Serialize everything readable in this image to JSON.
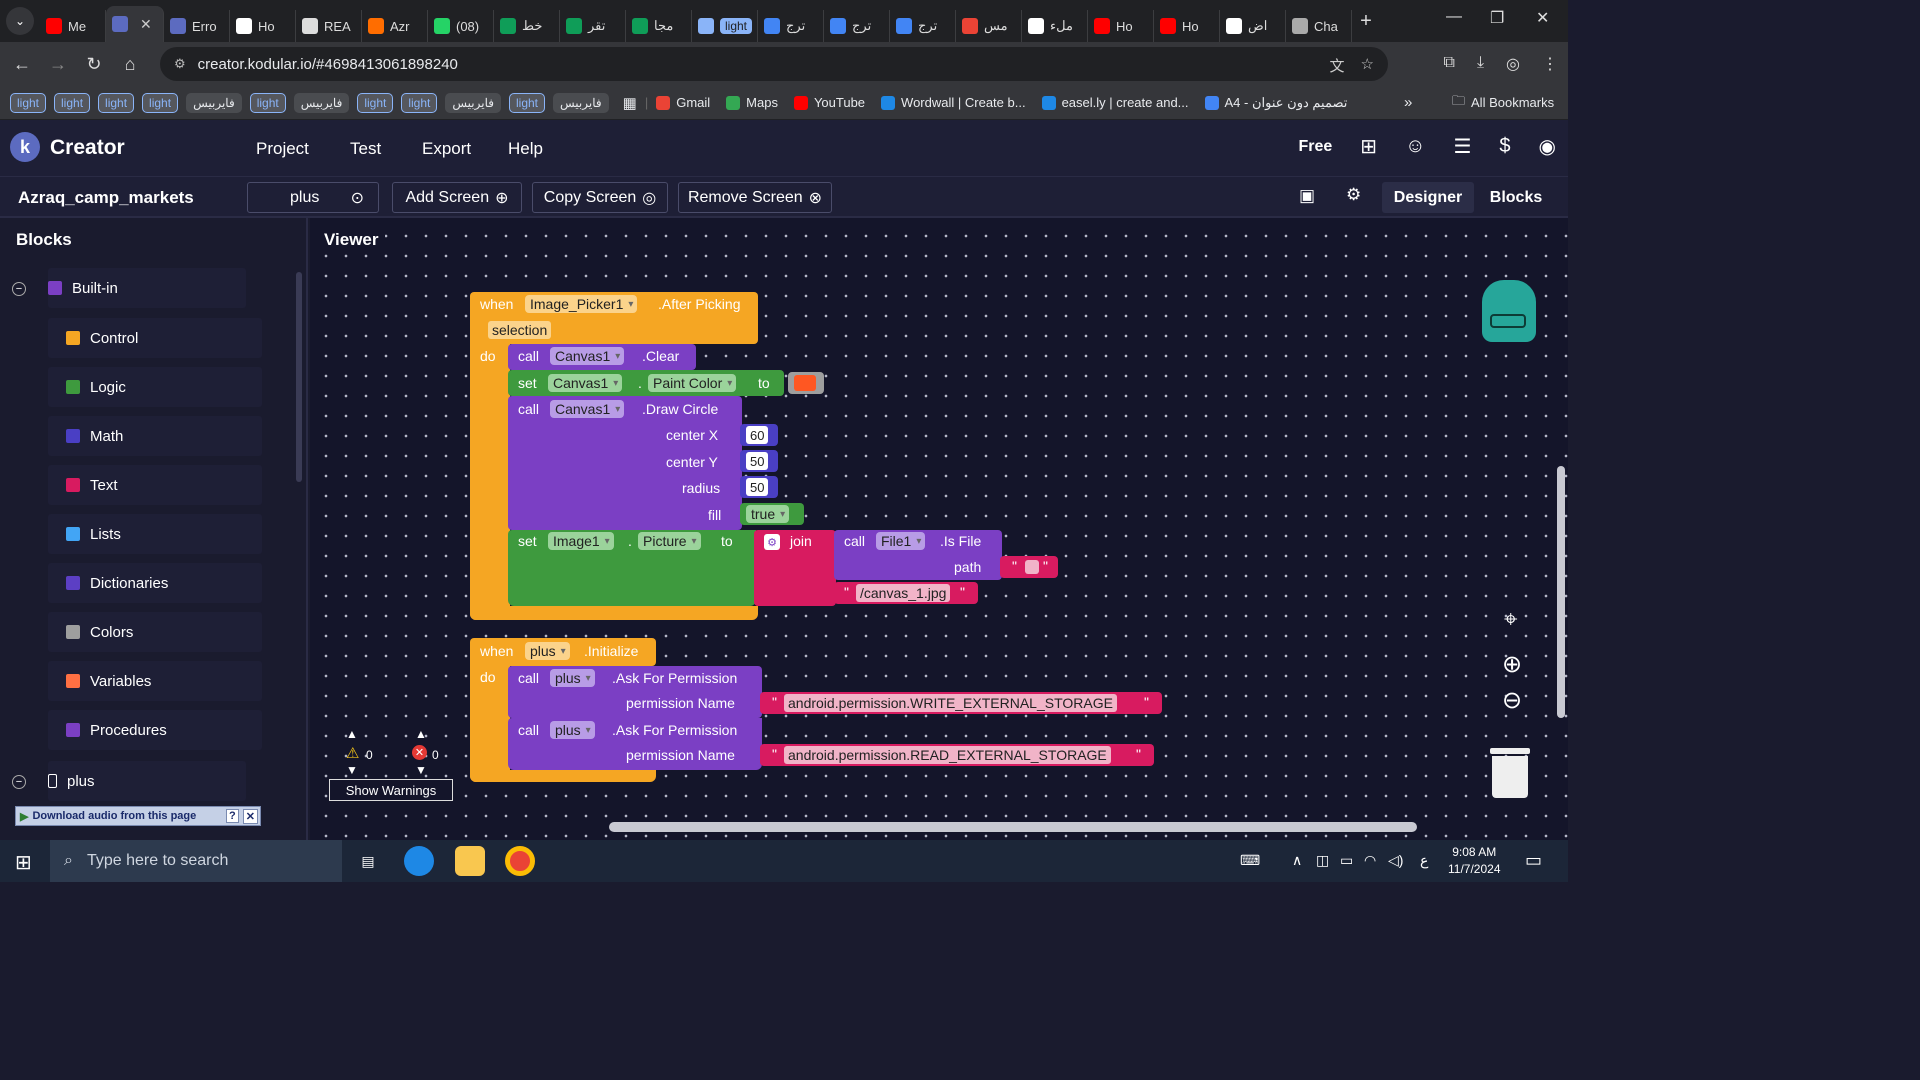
{
  "browser": {
    "tabs": [
      {
        "title": "Me",
        "color": "#ff0000"
      },
      {
        "title": "",
        "color": "#5c6bc0",
        "active": true
      },
      {
        "title": "Erro",
        "color": "#5c6bc0"
      },
      {
        "title": "Ho",
        "color": "#ffffff"
      },
      {
        "title": "REA",
        "color": "#dddddd"
      },
      {
        "title": "Azr",
        "color": "#ff6d00"
      },
      {
        "title": "(08)",
        "color": "#25d366"
      },
      {
        "title": "خط",
        "color": "#0f9d58"
      },
      {
        "title": "تقر",
        "color": "#0f9d58"
      },
      {
        "title": "مجا",
        "color": "#0f9d58"
      },
      {
        "title": "light",
        "color": "#8ab4f8",
        "chip": true
      },
      {
        "title": "ترج",
        "color": "#4285f4"
      },
      {
        "title": "ترج",
        "color": "#4285f4"
      },
      {
        "title": "ترج",
        "color": "#4285f4"
      },
      {
        "title": "مس",
        "color": "#ea4335"
      },
      {
        "title": "ملء",
        "color": "#ffffff"
      },
      {
        "title": "Ho",
        "color": "#ff0000"
      },
      {
        "title": "Ho",
        "color": "#ff0000"
      },
      {
        "title": "اض",
        "color": "#ffffff"
      },
      {
        "title": "Cha",
        "color": "#aaaaaa"
      }
    ],
    "url": "creator.kodular.io/#4698413061898240",
    "bookmark_chips": [
      "light",
      "light",
      "light",
      "light",
      "فايربيس",
      "light",
      "فايربيس",
      "light",
      "light",
      "فايربيس",
      "light",
      "فايربيس"
    ],
    "bookmarks": [
      {
        "label": "Gmail",
        "color": "#ea4335"
      },
      {
        "label": "Maps",
        "color": "#34a853"
      },
      {
        "label": "YouTube",
        "color": "#ff0000"
      },
      {
        "label": "Wordwall | Create b...",
        "color": "#1e88e5"
      },
      {
        "label": "easel.ly | create and...",
        "color": "#1e88e5"
      },
      {
        "label": "A4 - تصميم دون عنوان",
        "color": "#4285f4"
      }
    ],
    "all_bookmarks": "All Bookmarks"
  },
  "app": {
    "brand": "Creator",
    "logo_letter": "k",
    "menu": [
      "Project",
      "Test",
      "Export",
      "Help"
    ],
    "plan": "Free",
    "project_name": "Azraq_camp_markets",
    "screen_select": "plus",
    "add_screen": "Add Screen",
    "copy_screen": "Copy Screen",
    "remove_screen": "Remove Screen",
    "designer": "Designer",
    "blocks": "Blocks"
  },
  "sidebar": {
    "title": "Blocks",
    "builtin": "Built-in",
    "categories": [
      {
        "label": "Control",
        "color": "#f5a623"
      },
      {
        "label": "Logic",
        "color": "#3e9a3e"
      },
      {
        "label": "Math",
        "color": "#4a3fc4"
      },
      {
        "label": "Text",
        "color": "#d81b60"
      },
      {
        "label": "Lists",
        "color": "#42a5f5"
      },
      {
        "label": "Dictionaries",
        "color": "#5c3fc4"
      },
      {
        "label": "Colors",
        "color": "#9e9e9e"
      },
      {
        "label": "Variables",
        "color": "#ff7043"
      },
      {
        "label": "Procedures",
        "color": "#7b3fc4"
      }
    ],
    "screen_node": "plus",
    "download_audio": "Download audio from this page"
  },
  "viewer": {
    "title": "Viewer",
    "event1": {
      "when": "when",
      "component": "Image_Picker1",
      "event": ".After Picking",
      "param": "selection",
      "do": "do",
      "clear_call": "call",
      "clear_comp": "Canvas1",
      "clear_method": ".Clear",
      "set": "set",
      "set_comp": "Canvas1",
      "dot": ".",
      "set_prop": "Paint Color",
      "to": "to",
      "paint_color": "#ff5722",
      "draw_call": "call",
      "draw_comp": "Canvas1",
      "draw_method": ".Draw Circle",
      "cx_label": "center X",
      "cx": "60",
      "cy_label": "center Y",
      "cy": "50",
      "r_label": "radius",
      "r": "50",
      "fill_label": "fill",
      "fill": "true",
      "set2": "set",
      "set2_comp": "Image1",
      "set2_prop": "Picture",
      "to2": "to",
      "join": "join",
      "file_call": "call",
      "file_comp": "File1",
      "file_method": ".Is File",
      "path_label": "path",
      "quote_open": "\"",
      "quote_close": "\"",
      "canvas_file": "/canvas_1.jpg"
    },
    "event2": {
      "when": "when",
      "component": "plus",
      "event": ".Initialize",
      "do": "do",
      "call1": "call",
      "comp1": "plus",
      "method1": ".Ask For Permission",
      "param1": "permission Name",
      "perm1": "android.permission.WRITE_EXTERNAL_STORAGE",
      "call2": "call",
      "comp2": "plus",
      "method2": ".Ask For Permission",
      "param2": "permission Name",
      "perm2": "android.permission.READ_EXTERNAL_STORAGE"
    },
    "warnings_count": "0",
    "errors_count": "0",
    "show_warnings": "Show Warnings"
  },
  "taskbar": {
    "search_placeholder": "Type here to search",
    "time": "9:08 AM",
    "date": "11/7/2024",
    "lang": "ع"
  }
}
